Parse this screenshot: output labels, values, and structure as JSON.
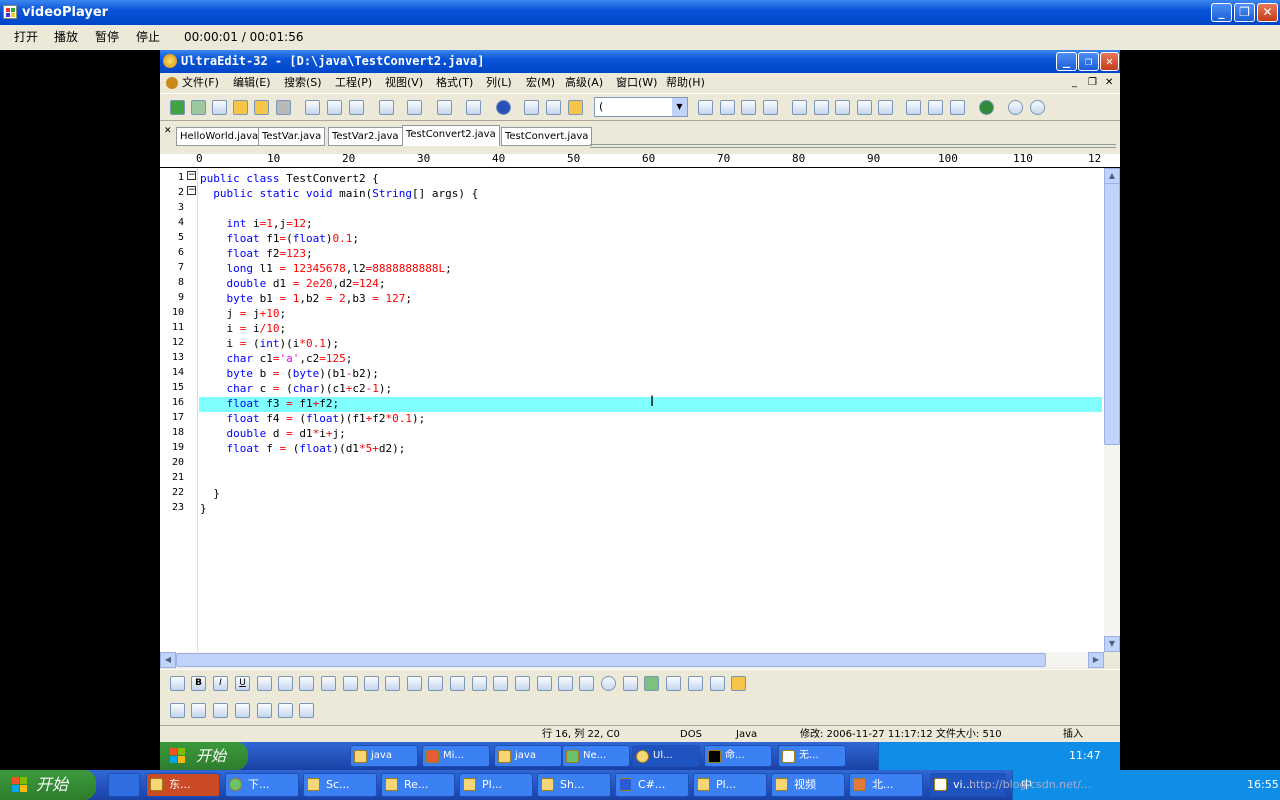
{
  "outer_window": {
    "title": "videoPlayer",
    "menu": [
      "打开",
      "播放",
      "暂停",
      "停止"
    ],
    "time": "00:00:01 / 00:01:56"
  },
  "ultraedit": {
    "title": "UltraEdit-32 - [D:\\java\\TestConvert2.java]",
    "menu": [
      "文件(F)",
      "编辑(E)",
      "搜索(S)",
      "工程(P)",
      "视图(V)",
      "格式(T)",
      "列(L)",
      "宏(M)",
      "高级(A)",
      "窗口(W)",
      "帮助(H)"
    ],
    "combo_value": "(",
    "tabs": [
      "HelloWorld.java",
      "TestVar.java",
      "TestVar2.java",
      "TestConvert2.java",
      "TestConvert.java"
    ],
    "active_tab": 3,
    "ruler": [
      "0",
      "10",
      "20",
      "30",
      "40",
      "50",
      "60",
      "70",
      "80",
      "90",
      "100",
      "110",
      "12"
    ],
    "line_numbers": [
      "1",
      "2",
      "3",
      "4",
      "5",
      "6",
      "7",
      "8",
      "9",
      "10",
      "11",
      "12",
      "13",
      "14",
      "15",
      "16",
      "17",
      "18",
      "19",
      "20",
      "21",
      "22",
      "23"
    ],
    "highlighted_line": 16,
    "status": {
      "position": "行 16, 列 22, C0",
      "format": "DOS",
      "language": "Java",
      "modified": "修改: 2006-11-27 11:17:12 文件大小: 510",
      "mode": "插入"
    }
  },
  "inner_taskbar": {
    "start": "开始",
    "items": [
      "java",
      "Mi...",
      "java",
      "Ne...",
      "Ul...",
      "命...",
      "无..."
    ],
    "clock": "11:47"
  },
  "outer_taskbar": {
    "start": "开始",
    "items": [
      "东...",
      "下...",
      "Sc...",
      "Re...",
      "Pl...",
      "Sh...",
      "C#...",
      "Pl...",
      "视频",
      "北...",
      "vi..."
    ],
    "ime": "中",
    "clock": "16:55",
    "watermark": "http://blog.csdn.net/..."
  },
  "colors": {
    "keyword": "#0000ff",
    "operator": "#ff0000",
    "string": "#ff00ff",
    "highlight": "#80ffff",
    "xp_title": "#0a55d8"
  }
}
